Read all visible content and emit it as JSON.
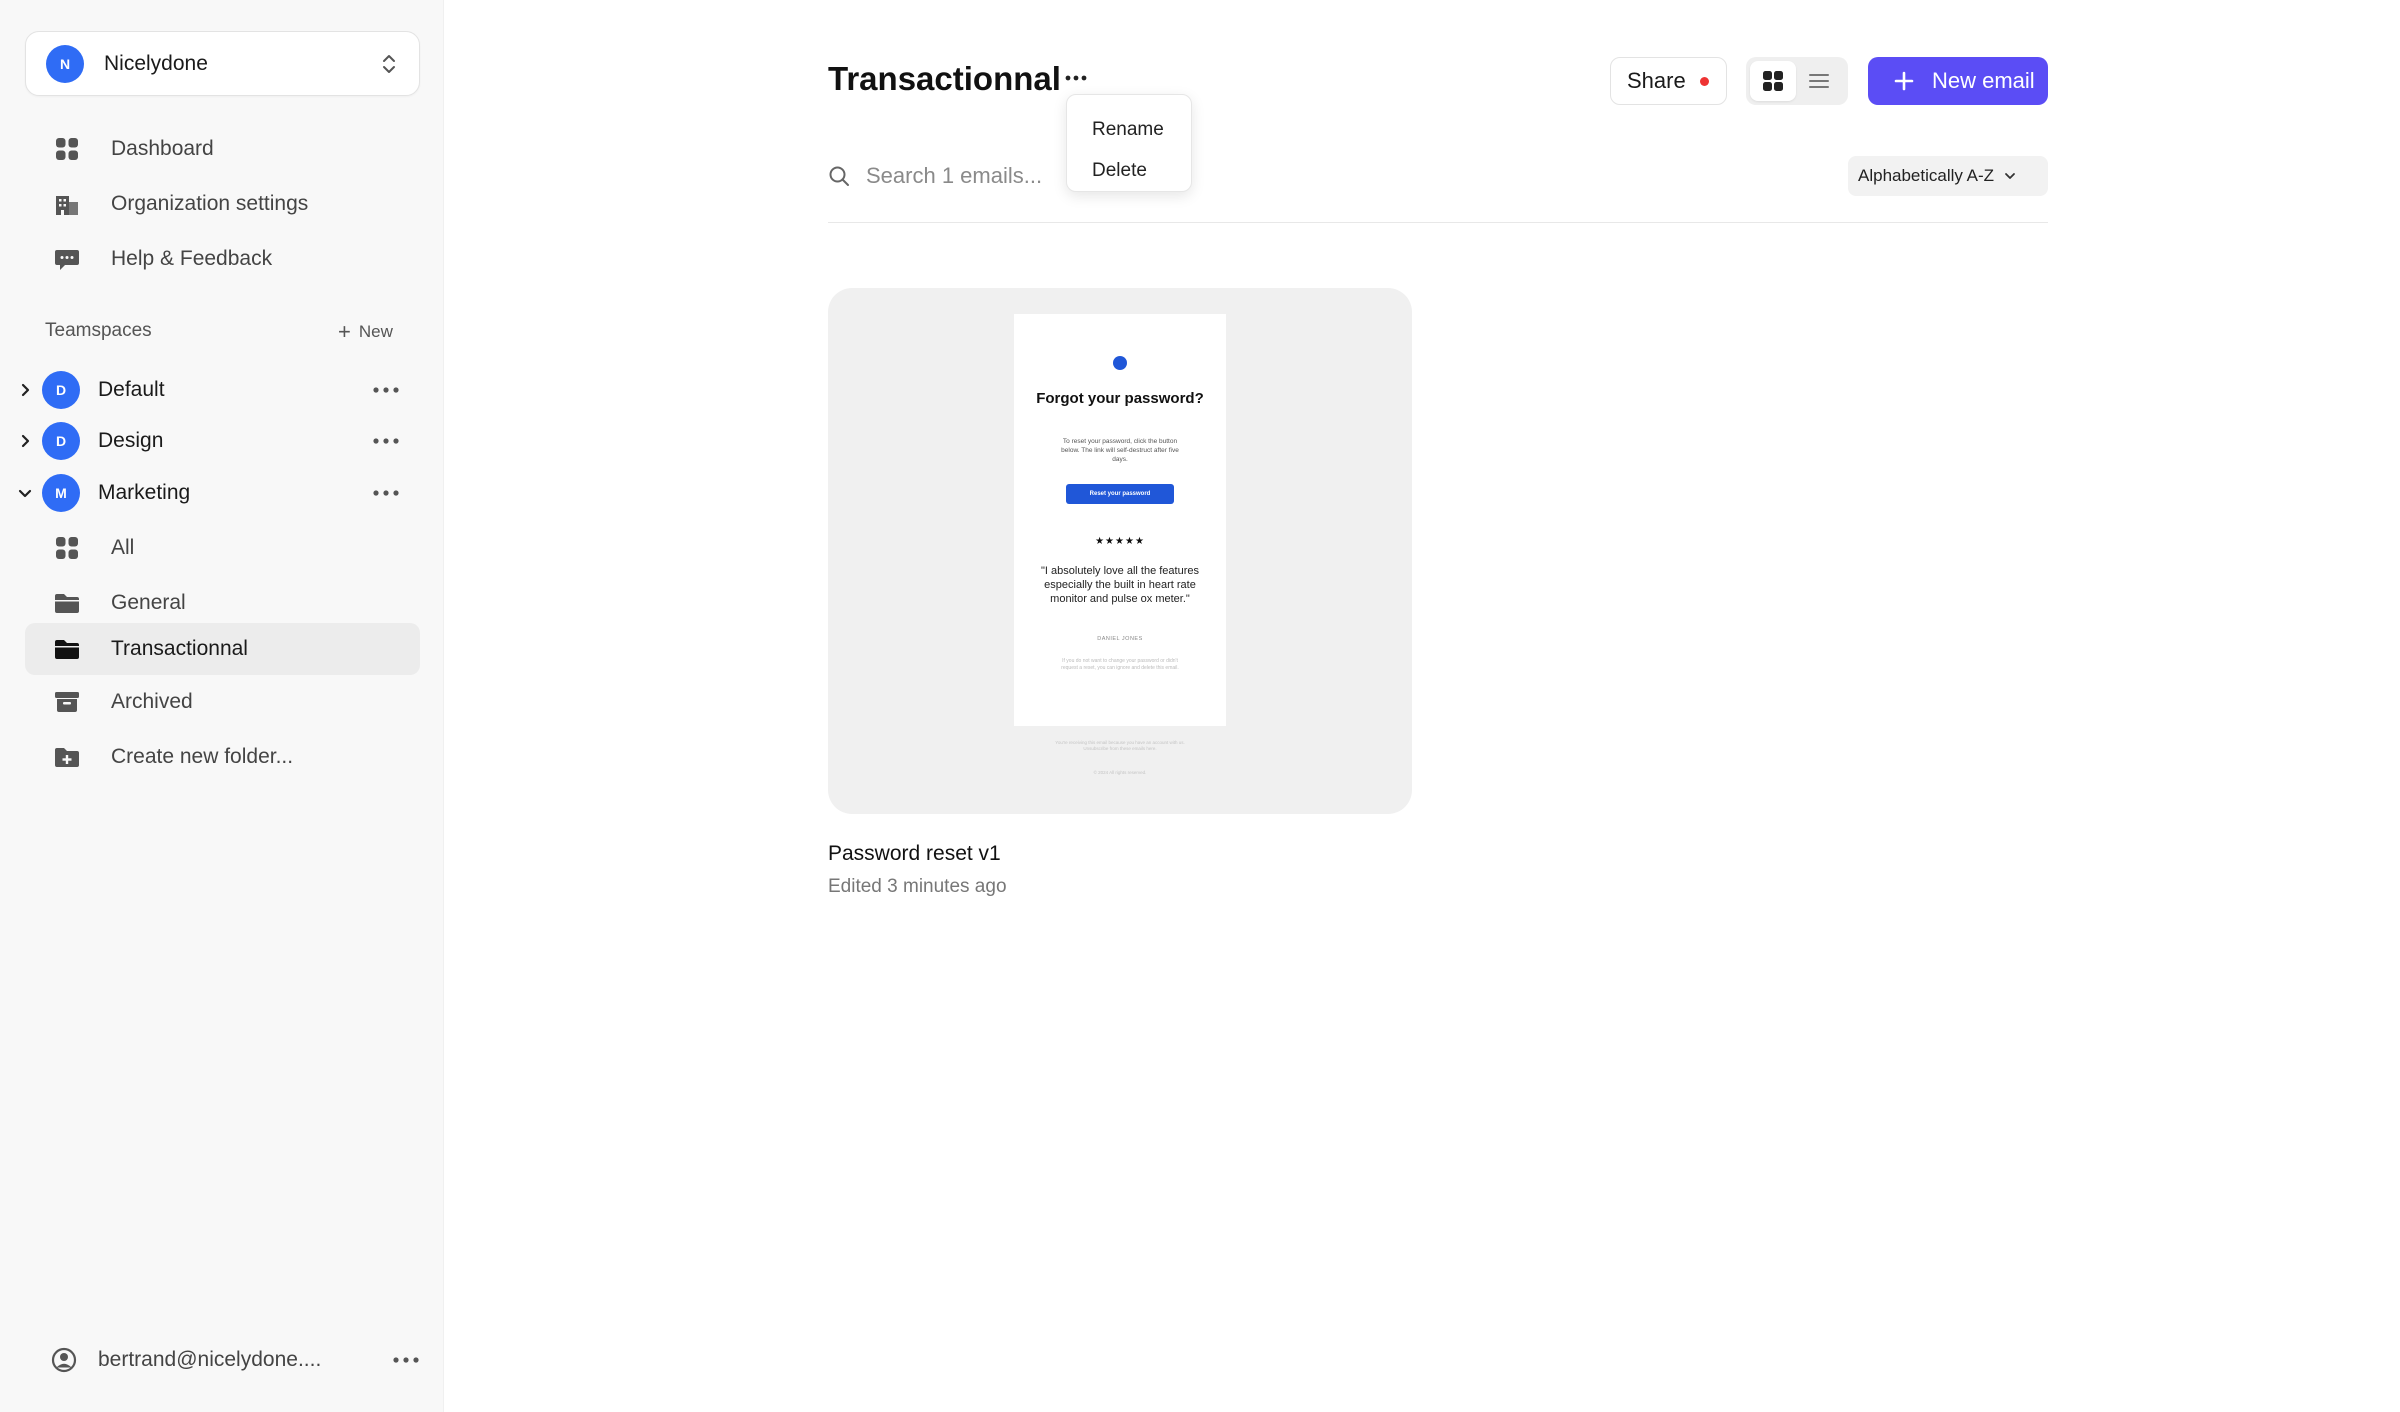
{
  "workspace": {
    "initial": "N",
    "name": "Nicelydone"
  },
  "nav": [
    {
      "label": "Dashboard",
      "icon": "dashboard-grid-icon"
    },
    {
      "label": "Organization settings",
      "icon": "building-icon"
    },
    {
      "label": "Help & Feedback",
      "icon": "chat-bubble-icon"
    }
  ],
  "teamspaces": {
    "label": "Teamspaces",
    "new_label": "New",
    "items": [
      {
        "initial": "D",
        "name": "Default",
        "expanded": false
      },
      {
        "initial": "D",
        "name": "Design",
        "expanded": false
      },
      {
        "initial": "M",
        "name": "Marketing",
        "expanded": true
      }
    ]
  },
  "folders": [
    {
      "label": "All",
      "icon": "grid-icon"
    },
    {
      "label": "General",
      "icon": "folder-icon"
    },
    {
      "label": "Transactionnal",
      "icon": "folder-open-icon",
      "active": true
    },
    {
      "label": "Archived",
      "icon": "archive-icon"
    },
    {
      "label": "Create new folder...",
      "icon": "folder-plus-icon"
    }
  ],
  "user": {
    "email": "bertrand@nicelydone...."
  },
  "page": {
    "title": "Transactionnal"
  },
  "context_menu": {
    "rename": "Rename",
    "delete": "Delete"
  },
  "toolbar": {
    "share_label": "Share",
    "new_email_label": "New email",
    "search_placeholder": "Search 1 emails...",
    "sort_label": "Alphabetically A-Z"
  },
  "colors": {
    "accent": "#5b4df5",
    "avatar": "#2f6cf5",
    "notification": "#ee3333",
    "email_brand": "#2057d8"
  },
  "cards": [
    {
      "title": "Password reset v1",
      "subtitle": "Edited 3 minutes ago",
      "preview": {
        "heading": "Forgot your password?",
        "body": "To reset your password, click the button below. The link will self-destruct after five days.",
        "button": "Reset your password",
        "stars": "★★★★★",
        "quote": "\"I absolutely love all the features especially the built in heart rate monitor and pulse ox meter.\"",
        "author": "DANIEL JONES",
        "fine_print": "If you do not want to change your password or didn't request a reset, you can ignore and delete this email.",
        "footer": "You're receiving this email because you have an account with us. Unsubscribe from these emails here.",
        "footer2": "© 2024 All rights reserved."
      }
    }
  ]
}
